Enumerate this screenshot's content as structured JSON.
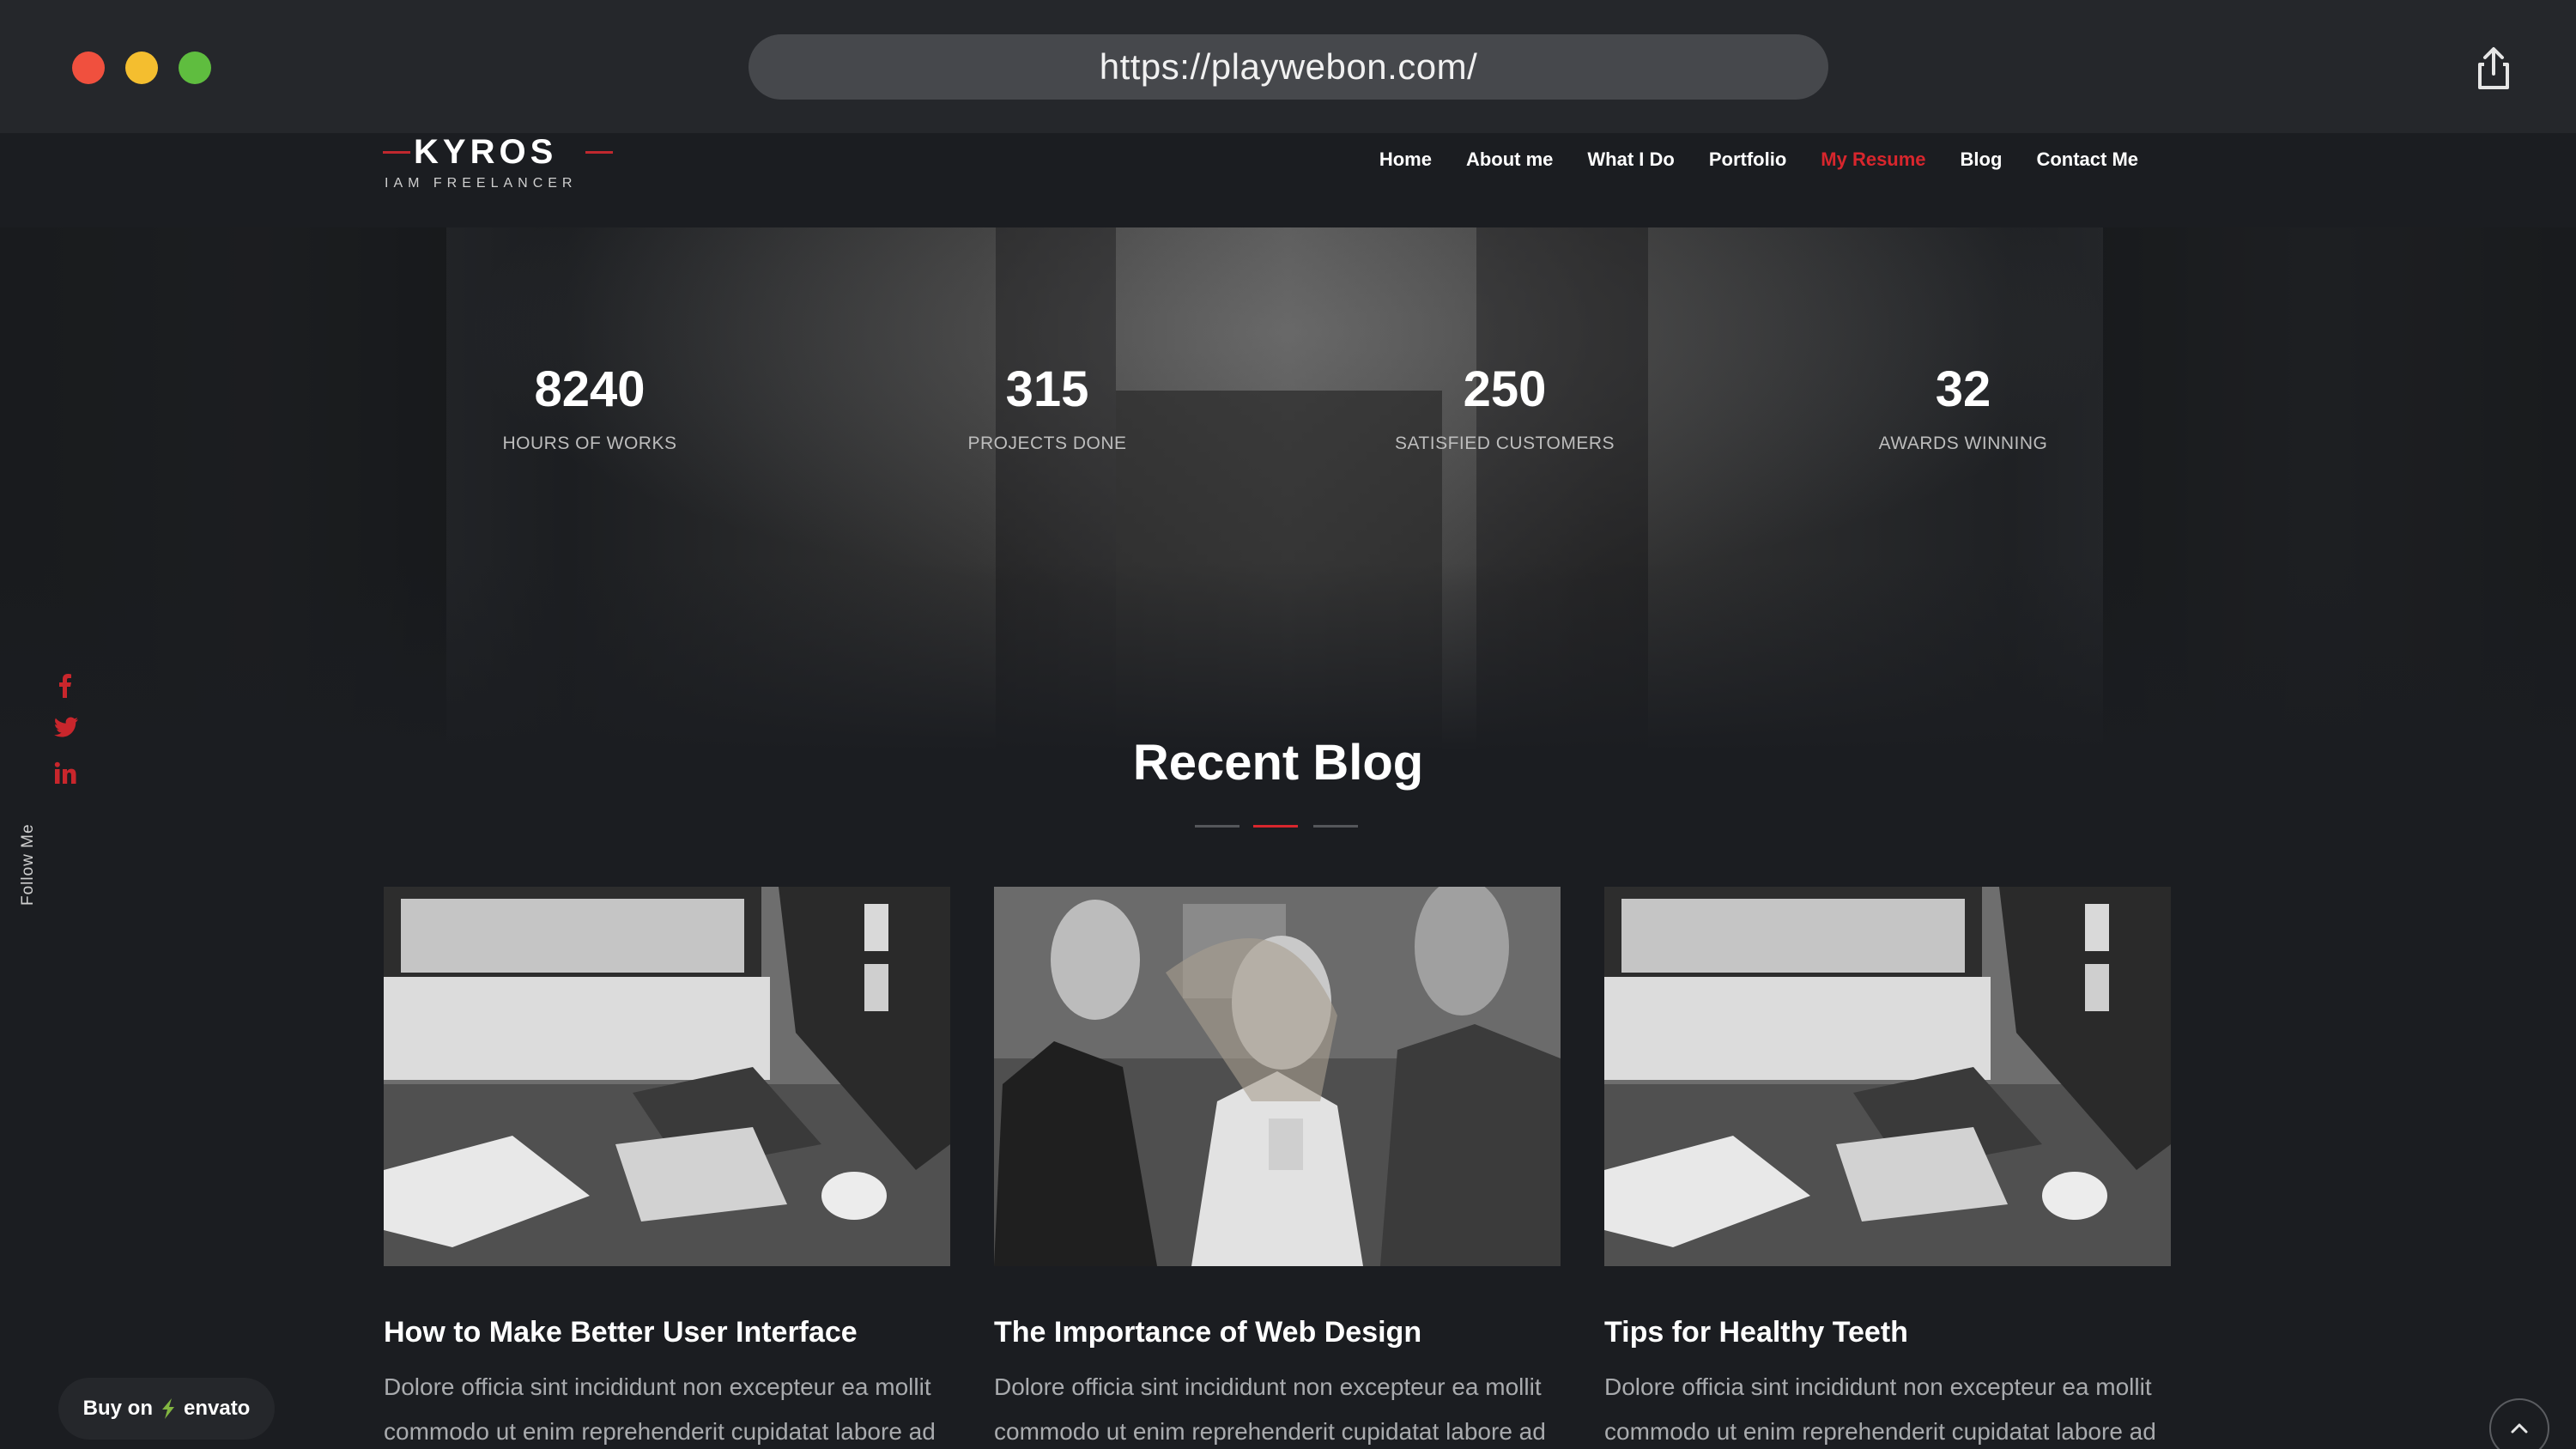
{
  "browser": {
    "url": "https://playwebon.com/"
  },
  "brand": {
    "name": "KYROS",
    "tagline": "IAM FREELANCER",
    "accent": "#d8262d"
  },
  "nav": {
    "items": [
      {
        "label": "Home"
      },
      {
        "label": "About me"
      },
      {
        "label": "What I Do"
      },
      {
        "label": "Portfolio"
      },
      {
        "label": "My Resume",
        "active": true
      },
      {
        "label": "Blog"
      },
      {
        "label": "Contact Me"
      }
    ]
  },
  "counters": [
    {
      "value": "8240",
      "label": "HOURS OF WORKS"
    },
    {
      "value": "315",
      "label": "PROJECTS DONE"
    },
    {
      "value": "250",
      "label": "SATISFIED CUSTOMERS"
    },
    {
      "value": "32",
      "label": "AWARDS WINNING"
    }
  ],
  "social": {
    "label": "Follow Me",
    "icons": [
      "facebook-icon",
      "twitter-icon",
      "linkedin-icon"
    ]
  },
  "blog": {
    "heading": "Recent Blog",
    "posts": [
      {
        "title": "How to Make Better User Interface",
        "excerpt": "Dolore officia sint incididunt non excepteur ea mollit commodo ut enim reprehenderit cupidatat labore ad",
        "image": "desk-computer-photo"
      },
      {
        "title": "The Importance of Web Design",
        "excerpt": "Dolore officia sint incididunt non excepteur ea mollit commodo ut enim reprehenderit cupidatat labore ad",
        "image": "people-talking-photo"
      },
      {
        "title": "Tips for Healthy Teeth",
        "excerpt": "Dolore officia sint incididunt non excepteur ea mollit commodo ut enim reprehenderit cupidatat labore ad",
        "image": "desk-computer-photo"
      }
    ]
  },
  "envato": {
    "prefix": "Buy on",
    "brand": "envato"
  }
}
